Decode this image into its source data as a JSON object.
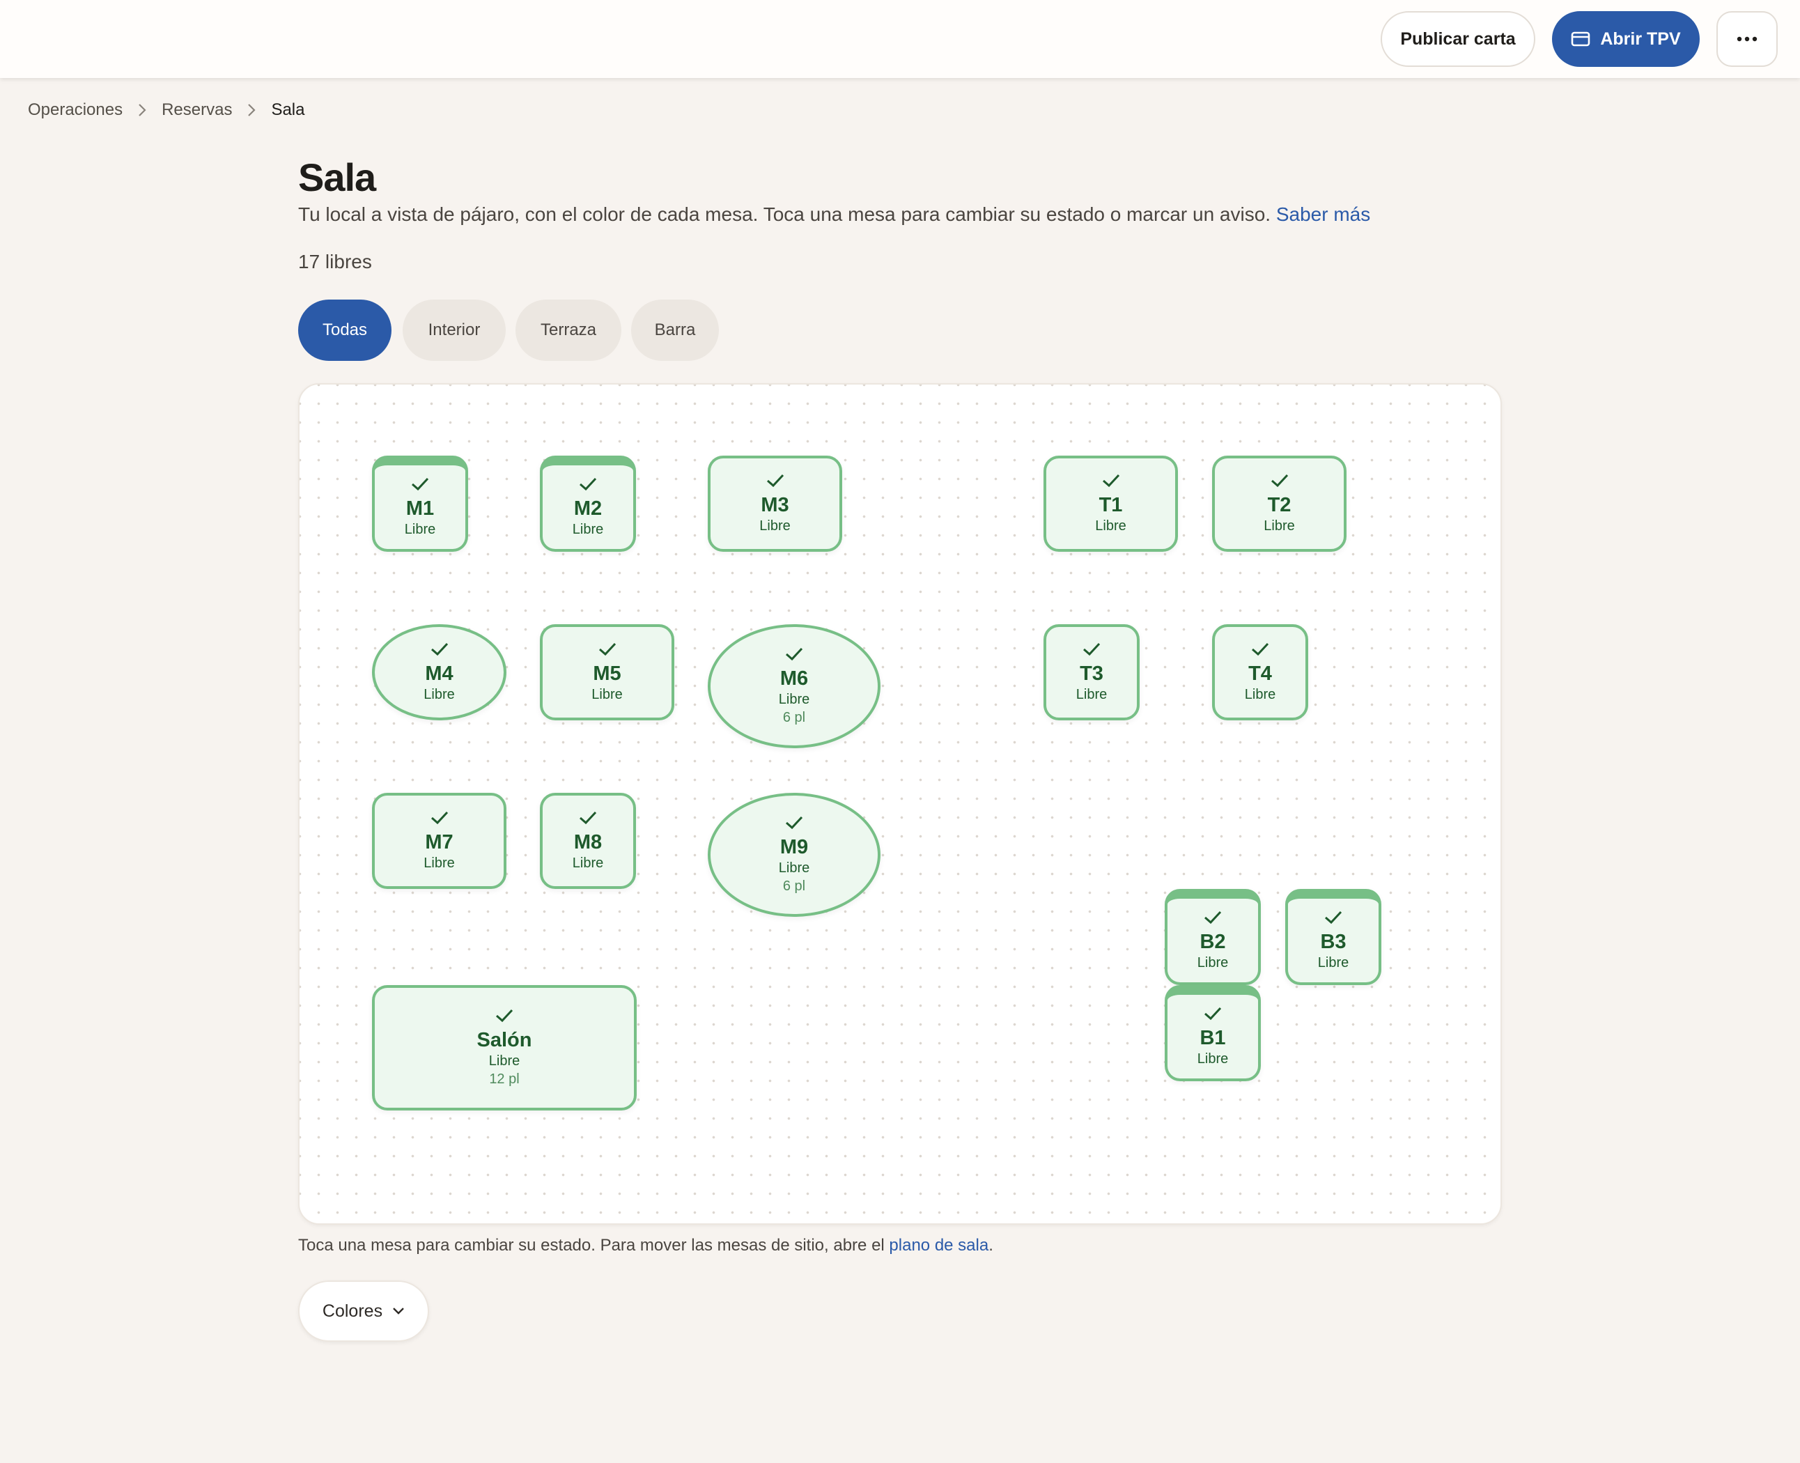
{
  "header": {
    "publish_label": "Publicar carta",
    "open_pos_label": "Abrir TPV",
    "more_label": "..."
  },
  "breadcrumb": [
    "Operaciones",
    "Reservas",
    "Sala"
  ],
  "page": {
    "title": "Sala",
    "subtitle": "Tu local a vista de pájaro, con el color de cada mesa. Toca una mesa para cambiar su estado o marcar un aviso.",
    "learn_more": "Saber más",
    "free_count": "17 libres"
  },
  "filters": [
    "Todas",
    "Interior",
    "Terraza",
    "Barra"
  ],
  "active_filter": "Todas",
  "tables": [
    {
      "name": "M1",
      "status": "Libre",
      "seats": ""
    },
    {
      "name": "M2",
      "status": "Libre",
      "seats": ""
    },
    {
      "name": "M3",
      "status": "Libre",
      "seats": ""
    },
    {
      "name": "T1",
      "status": "Libre",
      "seats": ""
    },
    {
      "name": "T2",
      "status": "Libre",
      "seats": ""
    },
    {
      "name": "M4",
      "status": "Libre",
      "seats": ""
    },
    {
      "name": "M5",
      "status": "Libre",
      "seats": ""
    },
    {
      "name": "M6",
      "status": "Libre",
      "seats": "6 pl"
    },
    {
      "name": "T3",
      "status": "Libre",
      "seats": ""
    },
    {
      "name": "T4",
      "status": "Libre",
      "seats": ""
    },
    {
      "name": "M7",
      "status": "Libre",
      "seats": ""
    },
    {
      "name": "M8",
      "status": "Libre",
      "seats": ""
    },
    {
      "name": "M9",
      "status": "Libre",
      "seats": "6 pl"
    },
    {
      "name": "B2",
      "status": "Libre",
      "seats": ""
    },
    {
      "name": "B3",
      "status": "Libre",
      "seats": ""
    },
    {
      "name": "Salón",
      "status": "Libre",
      "seats": "12 pl"
    },
    {
      "name": "B1",
      "status": "Libre",
      "seats": ""
    }
  ],
  "footnote": {
    "text": "Toca una mesa para cambiar su estado. Para mover las mesas de sitio, abre el",
    "link": "plano de sala",
    "end": "."
  },
  "colors_label": "Colores",
  "colors": {
    "primary": "#2b5aa8",
    "free_border": "#77bf86",
    "free_fill": "#edf8ef",
    "free_text": "#1e5a2c"
  },
  "icons": {
    "open_pos": "card-icon",
    "more": "ellipsis-icon",
    "breadcrumb_sep": "chevron-right-icon",
    "table_status": "check-icon",
    "colors": "chevron-down-icon"
  }
}
